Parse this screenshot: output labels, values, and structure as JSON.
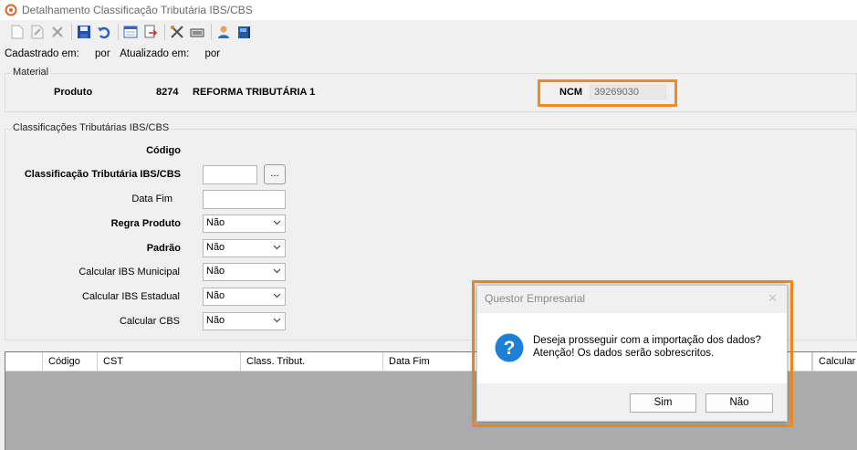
{
  "window": {
    "title": "Detalhamento Classificação Tributária IBS/CBS"
  },
  "toolbar": {
    "buttons": [
      "new-doc-icon",
      "edit-doc-icon",
      "delete-icon",
      "save-icon",
      "undo-icon",
      "calendar-icon",
      "export-icon",
      "tools-icon",
      "keyboard-icon",
      "user-icon",
      "book-icon"
    ]
  },
  "audit": {
    "created_label": "Cadastrado em:",
    "created_by_label": "por",
    "updated_label": "Atualizado em:",
    "updated_by_label": "por"
  },
  "material": {
    "legend": "Material",
    "produto_label": "Produto",
    "produto_code": "8274",
    "produto_name": "REFORMA TRIBUTÁRIA 1",
    "ncm_label": "NCM",
    "ncm_value": "39269030"
  },
  "classificacoes": {
    "legend": "Classificações Tributárias IBS/CBS",
    "codigo_label": "Código",
    "class_label": "Classificação Tributária IBS/CBS",
    "class_value": "",
    "dots_label": "...",
    "data_fim_label": "Data Fim",
    "data_fim_value": "",
    "regra_produto_label": "Regra Produto",
    "regra_produto_value": "Não",
    "padrao_label": "Padrão",
    "padrao_value": "Não",
    "ibs_municipal_label": "Calcular IBS Municipal",
    "ibs_municipal_value": "Não",
    "ibs_estadual_label": "Calcular IBS Estadual",
    "ibs_estadual_value": "Não",
    "cbs_label": "Calcular CBS",
    "cbs_value": "Não"
  },
  "grid": {
    "columns": [
      "",
      "Código",
      "CST",
      "Class. Tribut.",
      "Data Fim",
      "Calcular I"
    ]
  },
  "dialog": {
    "title": "Questor Empresarial",
    "close": "✕",
    "message_line1": "Deseja prosseguir com a importação dos dados?",
    "message_line2": "Atenção! Os dados serão sobrescritos.",
    "yes_label": "Sim",
    "no_label": "Não"
  },
  "colors": {
    "highlight": "#f28a1c",
    "question_icon": "#1e7fd6"
  }
}
